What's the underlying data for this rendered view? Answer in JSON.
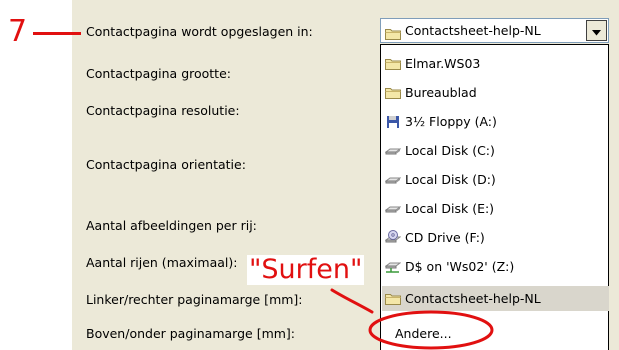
{
  "annotations": {
    "step_number": "7",
    "callout": "\"Surfen\""
  },
  "form": {
    "labels": [
      "Contactpagina wordt opgeslagen in:",
      "Contactpagina grootte:",
      "Contactpagina resolutie:",
      "Contactpagina orientatie:",
      "Aantal afbeeldingen per rij:",
      "Aantal rijen (maximaal):",
      "Linker/rechter paginamarge [mm]:",
      "Boven/onder paginamarge [mm]:"
    ]
  },
  "combo": {
    "value": "Contactsheet-help-NL",
    "icon": "folder-icon"
  },
  "dropdown": {
    "items": [
      {
        "label": "Elmar.WS03",
        "icon": "folder-icon"
      },
      {
        "label": "Bureaublad",
        "icon": "folder-icon"
      },
      {
        "label": "3½ Floppy (A:)",
        "icon": "floppy-icon"
      },
      {
        "label": "Local Disk (C:)",
        "icon": "hard-disk-icon"
      },
      {
        "label": "Local Disk (D:)",
        "icon": "hard-disk-icon"
      },
      {
        "label": "Local Disk (E:)",
        "icon": "hard-disk-icon"
      },
      {
        "label": "CD Drive (F:)",
        "icon": "cd-drive-icon"
      },
      {
        "label": "D$ on 'Ws02' (Z:)",
        "icon": "network-drive-icon"
      },
      {
        "label": "Contactsheet-help-NL",
        "icon": "folder-icon",
        "selected": true
      },
      {
        "label": "Andere...",
        "icon": ""
      }
    ]
  },
  "colors": {
    "annotation_red": "#e11010",
    "dialog_bg": "#ece9d8"
  }
}
